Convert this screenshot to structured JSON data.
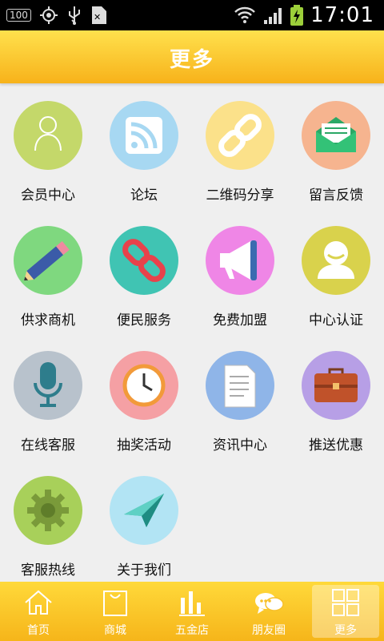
{
  "status_bar": {
    "battery_level_text": "100",
    "time": "17:01"
  },
  "header": {
    "title": "更多"
  },
  "grid": [
    {
      "label": "会员中心",
      "icon": "person-outline-icon",
      "color": "#c4d86a"
    },
    {
      "label": "论坛",
      "icon": "rss-icon",
      "color": "#a7d8f2"
    },
    {
      "label": "二维码分享",
      "icon": "chain-link-icon",
      "color": "#fbe18a"
    },
    {
      "label": "留言反馈",
      "icon": "envelope-icon",
      "color": "#f6b48f"
    },
    {
      "label": "供求商机",
      "icon": "pencil-icon",
      "color": "#7fd87f"
    },
    {
      "label": "便民服务",
      "icon": "red-link-icon",
      "color": "#40c4b3"
    },
    {
      "label": "免费加盟",
      "icon": "megaphone-icon",
      "color": "#ef86e6"
    },
    {
      "label": "中心认证",
      "icon": "user-badge-icon",
      "color": "#d9d24c"
    },
    {
      "label": "在线客服",
      "icon": "microphone-icon",
      "color": "#b8c2cc"
    },
    {
      "label": "抽奖活动",
      "icon": "clock-icon",
      "color": "#f5a0a4"
    },
    {
      "label": "资讯中心",
      "icon": "document-icon",
      "color": "#8fb5e8"
    },
    {
      "label": "推送优惠",
      "icon": "briefcase-icon",
      "color": "#b79fe6"
    },
    {
      "label": "客服热线",
      "icon": "gear-icon",
      "color": "#a8d05a"
    },
    {
      "label": "关于我们",
      "icon": "paper-plane-icon",
      "color": "#b2e4f4"
    }
  ],
  "tabs": [
    {
      "label": "首页",
      "icon": "home-icon"
    },
    {
      "label": "商城",
      "icon": "shopping-bag-icon"
    },
    {
      "label": "五金店",
      "icon": "bar-chart-icon"
    },
    {
      "label": "朋友圈",
      "icon": "chat-bubbles-icon"
    },
    {
      "label": "更多",
      "icon": "grid-icon",
      "active": true
    }
  ]
}
